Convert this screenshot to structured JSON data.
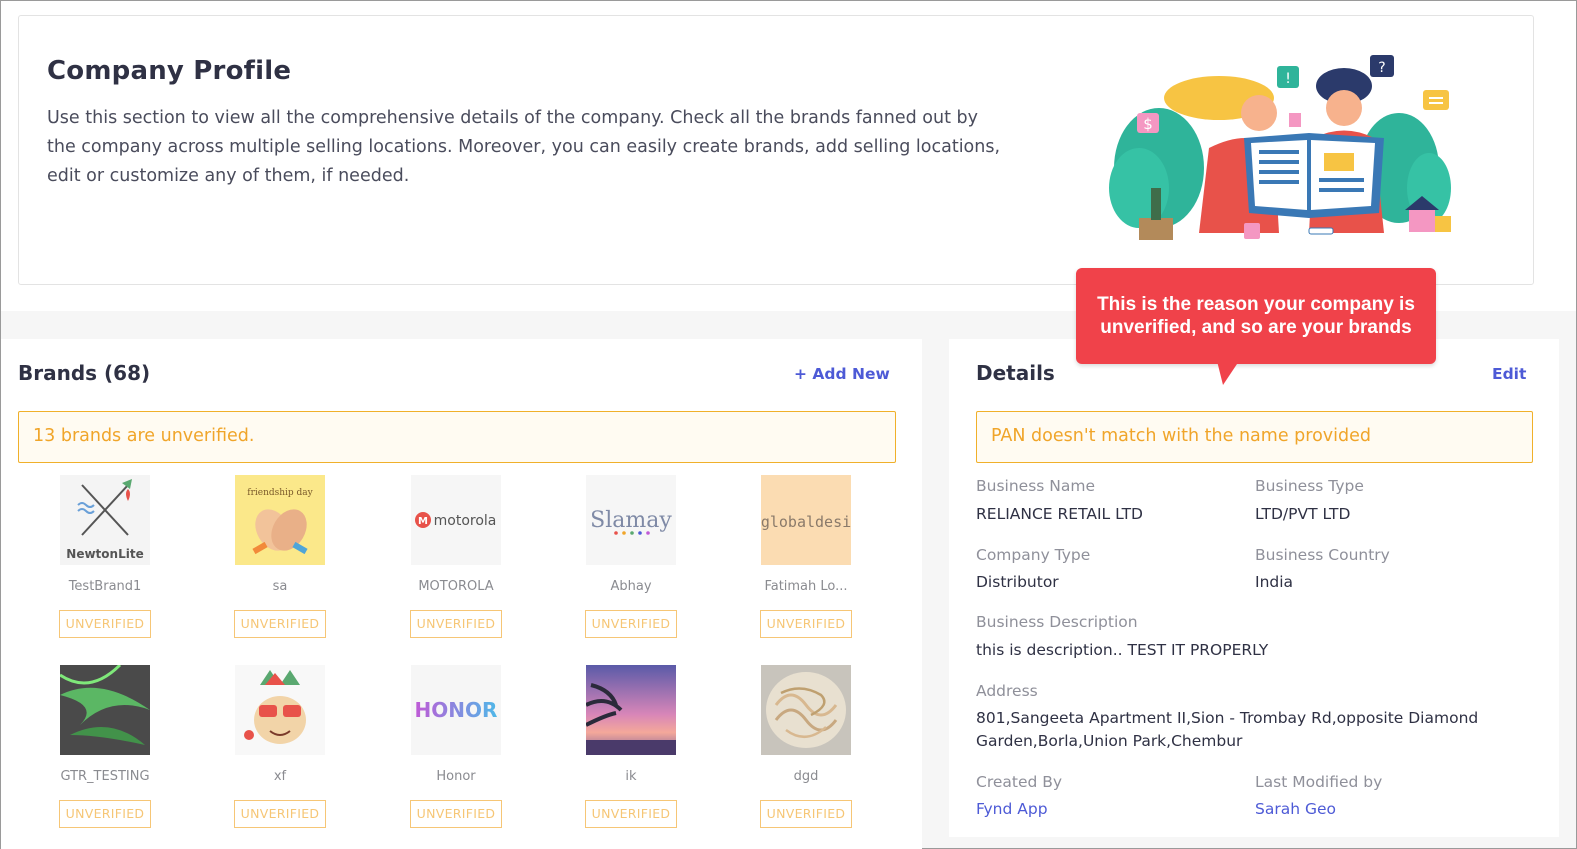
{
  "header": {
    "title": "Company Profile",
    "description": "Use this section to view all the comprehensive details of the company. Check all the brands fanned out by the company across multiple selling locations. Moreover, you can easily create brands, add selling locations, edit or customize any of them, if needed."
  },
  "brands": {
    "title": "Brands (68)",
    "add_label": "+ Add New",
    "warning": "13 brands are unverified.",
    "items": [
      {
        "name": "TestBrand1",
        "status": "UNVERIFIED",
        "logo": "newtonlite-logo"
      },
      {
        "name": "sa",
        "status": "UNVERIFIED",
        "logo": "friendship-day-logo"
      },
      {
        "name": "MOTOROLA",
        "status": "UNVERIFIED",
        "logo": "motorola-logo",
        "logo_text": "motorola"
      },
      {
        "name": "Abhay",
        "status": "UNVERIFIED",
        "logo": "slamay-logo",
        "logo_text": "Slamay"
      },
      {
        "name": "Fatimah Lo...",
        "status": "UNVERIFIED",
        "logo": "globaldesi-logo",
        "logo_text": "globaldesi"
      },
      {
        "name": "GTR_TESTING",
        "status": "UNVERIFIED",
        "logo": "green-swirl-logo"
      },
      {
        "name": "xf",
        "status": "UNVERIFIED",
        "logo": "party-character-logo"
      },
      {
        "name": "Honor",
        "status": "UNVERIFIED",
        "logo": "honor-logo",
        "logo_text": "HONOR"
      },
      {
        "name": "ik",
        "status": "UNVERIFIED",
        "logo": "sunset-palm-logo"
      },
      {
        "name": "dgd",
        "status": "UNVERIFIED",
        "logo": "noodles-logo"
      }
    ]
  },
  "details": {
    "title": "Details",
    "edit_label": "Edit",
    "warning": "PAN doesn't match with the name provided",
    "business_name_label": "Business Name",
    "business_name": "RELIANCE RETAIL LTD",
    "business_type_label": "Business Type",
    "business_type": "LTD/PVT LTD",
    "company_type_label": "Company Type",
    "company_type": "Distributor",
    "business_country_label": "Business Country",
    "business_country": "India",
    "description_label": "Business Description",
    "description": "this is description.. TEST IT PROPERLY",
    "address_label": "Address",
    "address_line1": "801,Sangeeta Apartment II,Sion - Trombay Rd,opposite Diamond",
    "address_line2": "Garden,Borla,Union Park,Chembur",
    "created_by_label": "Created By",
    "created_by": "Fynd App",
    "modified_by_label": "Last Modified by",
    "modified_by": "Sarah Geo"
  },
  "tooltip": {
    "line1": "This is the reason your company is",
    "line2": "unverified, and so are your brands"
  },
  "colors": {
    "accent": "#4d5ad6",
    "warning": "#f0a52a",
    "tooltip": "#f0424a"
  }
}
